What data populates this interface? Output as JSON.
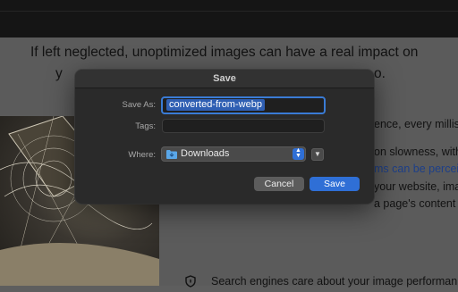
{
  "page": {
    "headline_line1": "If left neglected, unoptimized images can have a real impact on",
    "headline_line2": "y",
    "headline_line2_tail": "o.",
    "right_text_1": "ence, every milliso",
    "right_text_2": "on slowness, with",
    "right_text_3_link": "ms can be perceiv",
    "right_text_4": "your website, ima",
    "right_text_5": "a page's content",
    "bottom_text": "Search engines care about your image performan"
  },
  "dialog": {
    "title": "Save",
    "save_as_label": "Save As:",
    "save_as_value": "converted-from-webp",
    "tags_label": "Tags:",
    "tags_value": "",
    "where_label": "Where:",
    "where_value": "Downloads",
    "cancel_label": "Cancel",
    "save_label": "Save"
  },
  "colors": {
    "accent": "#2f6fd6",
    "dialog_bg": "#2a2a2a",
    "link": "#1d3f88"
  },
  "icons": {
    "folder": "folder-icon",
    "stepper": "chevron-updown-icon",
    "expand": "chevron-down-icon",
    "shield": "shield-icon"
  }
}
